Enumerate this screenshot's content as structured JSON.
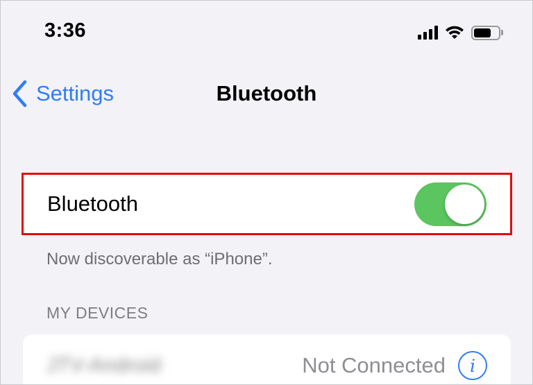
{
  "status_bar": {
    "time": "3:36",
    "signal_icon": "cellular-signal-icon",
    "wifi_icon": "wifi-icon",
    "battery_icon": "battery-icon",
    "battery_level": 0.7
  },
  "nav": {
    "back_label": "Settings",
    "title": "Bluetooth",
    "accent_color": "#2f7df6"
  },
  "bluetooth_row": {
    "label": "Bluetooth",
    "enabled": true,
    "toggle_color": "#5bc560",
    "highlight_color": "#e30a0a"
  },
  "discoverable_text": "Now discoverable as “iPhone”.",
  "my_devices": {
    "header": "MY DEVICES",
    "items": [
      {
        "name": "JTV-Android",
        "status": "Not Connected",
        "info_icon": "info-icon"
      }
    ]
  }
}
